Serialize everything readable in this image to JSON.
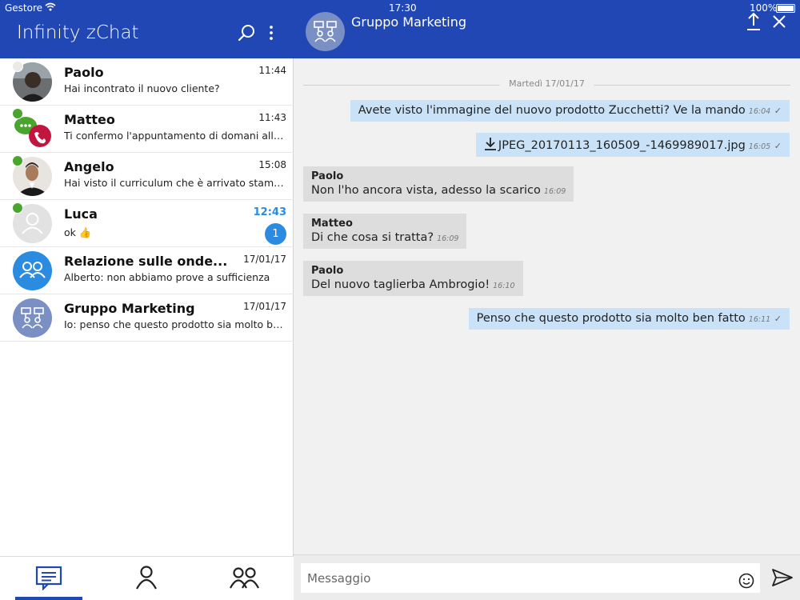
{
  "status_bar": {
    "carrier": "Gestore",
    "time": "17:30",
    "battery": "100%"
  },
  "app": {
    "title": "Infinity zChat"
  },
  "conversations": [
    {
      "name": "Paolo",
      "time": "11:44",
      "preview": "Hai incontrato il nuovo cliente?",
      "online_color": "#e9e9e9",
      "avatar": "photo-avatar"
    },
    {
      "name": "Matteo",
      "time": "11:43",
      "preview": "Ti confermo l'appuntamento di domani alle 1...",
      "online_color": "#4aa52e",
      "avatar": "chat-phone-avatar"
    },
    {
      "name": "Angelo",
      "time": "15:08",
      "preview": "Hai visto il curriculum che è arrivato stamatti...",
      "online_color": "#4aa52e",
      "avatar": "photo-avatar"
    },
    {
      "name": "Luca",
      "time": "12:43",
      "preview": "ok",
      "preview_emoji": "👍",
      "unread": "1",
      "online_color": "#4aa52e",
      "avatar": "default-user-avatar"
    },
    {
      "name": "Relazione sulle onde...",
      "time": "17/01/17",
      "preview": "Alberto: non abbiamo prove a sufficienza",
      "avatar": "group-avatar"
    },
    {
      "name": "Gruppo Marketing",
      "time": "17/01/17",
      "preview": "Io: penso che questo prodotto sia molto ben ...",
      "avatar": "group-org-avatar"
    }
  ],
  "chat": {
    "title": "Gruppo Marketing",
    "date_separator": "Martedì 17/01/17",
    "messages": [
      {
        "mine": true,
        "text": "Avete visto l'immagine del nuovo prodotto Zucchetti? Ve la mando",
        "time": "16:04",
        "status": "✓"
      },
      {
        "mine": true,
        "file": true,
        "text": "JPEG_20170113_160509_-1469989017.jpg",
        "time": "16:05",
        "status": "✓"
      },
      {
        "mine": false,
        "sender": "Paolo",
        "text": "Non l'ho ancora vista, adesso la scarico",
        "time": "16:09"
      },
      {
        "mine": false,
        "sender": "Matteo",
        "text": "Di che cosa si tratta?",
        "time": "16:09"
      },
      {
        "mine": false,
        "sender": "Paolo",
        "text": "Del nuovo taglierba Ambrogio!",
        "time": "16:10"
      },
      {
        "mine": true,
        "text": "Penso che questo prodotto sia molto ben fatto",
        "time": "16:11",
        "status": "✓"
      }
    ],
    "composer_placeholder": "Messaggio"
  },
  "tabs": [
    {
      "name": "chats-tab",
      "icon": "chat-bubble-icon",
      "active": true
    },
    {
      "name": "contacts-tab",
      "icon": "person-icon",
      "active": false
    },
    {
      "name": "groups-tab",
      "icon": "group-icon",
      "active": false
    }
  ],
  "colors": {
    "header": "#2047b4",
    "online": "#4aa52e",
    "accent": "#2a8be0",
    "my_bubble": "#c9e2f7",
    "their_bubble": "#dddddd"
  }
}
